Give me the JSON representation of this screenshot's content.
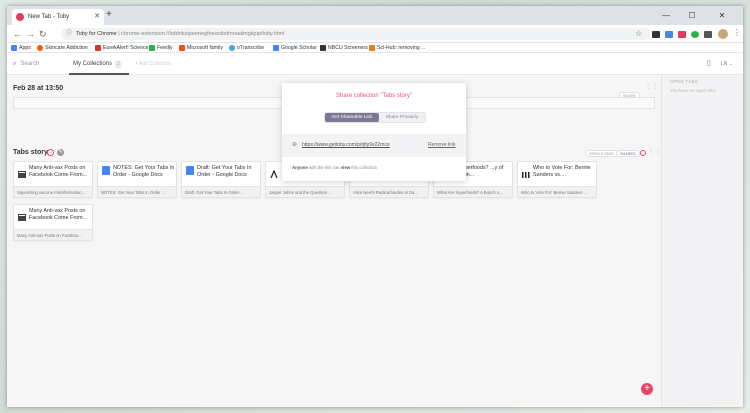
{
  "tab": {
    "title": "New Tab - Toby",
    "new": "+"
  },
  "window": {
    "min": "—",
    "max": "☐",
    "close": "✕"
  },
  "address": {
    "lock": "ⓘ",
    "host": "Toby for Chrome",
    "path": "chrome-extension://hddnkoipeenegfoeaoibdmnaalmgkpip/toby.html",
    "star": "☆"
  },
  "bookmarks": [
    {
      "label": "Apps",
      "color": "#4a86e8"
    },
    {
      "label": "Skincare Addiction",
      "color": "#ff5700"
    },
    {
      "label": "EurekAlert! Science ...",
      "color": "#d33"
    },
    {
      "label": "Feedly",
      "color": "#2bb24c"
    },
    {
      "label": "Microsoft family",
      "color": "#f25022"
    },
    {
      "label": "oTranscribe",
      "color": "#4aa3df"
    },
    {
      "label": "Google Scholar",
      "color": "#4285f4"
    },
    {
      "label": "NBCU Screeners",
      "color": "#333"
    },
    {
      "label": "Sci-Hub: removing ...",
      "color": "#e67e22"
    }
  ],
  "toolbar": {
    "search": "Search",
    "search_icon": "⌕",
    "collections": "My Collections",
    "count": "2",
    "add": "+ Add Collection"
  },
  "sidebar": {
    "heading": "OPEN TABS",
    "empty": "You have no open tabs"
  },
  "section1": {
    "title": "Feb 28 at 13:50",
    "share": "SHARE"
  },
  "section2": {
    "title": "Tabs story",
    "open": "OPEN 9 TABS",
    "share": "SHARED"
  },
  "cards": [
    {
      "title": "Many Anti-vax Posts on Facebook Come From...",
      "url": "Squelching vaccine misinformation...",
      "icon": "news"
    },
    {
      "title": "NOTES: Get Your Tabs In Order - Google Docs",
      "url": "NOTES: Get Your Tabs In Order ...",
      "icon": "doc"
    },
    {
      "title": "Draft: Get Your Tabs In Order - Google Docs",
      "url": "Draft: Get Your Tabs In Order ...",
      "icon": "doc"
    },
    {
      "title": "",
      "url": "Jasper Johns and the Question ...",
      "icon": "art"
    },
    {
      "title": "",
      "url": "Alice Neel's Radical Nudes at Da...",
      "icon": "art"
    },
    {
      "title": "...e Superfoods? ...y of Marketin...",
      "url": "What Are Superfoods? A Bunch o...",
      "icon": "news"
    },
    {
      "title": "Who to Vote For: Bernie Sanders vs....",
      "url": "Who to Vote For: Bernie Sanders ...",
      "icon": "nyt"
    },
    {
      "title": "Many Anti-vax Posts on Facebook Come From...",
      "url": "Many Anti-vax Posts on Faceboo...",
      "icon": "news"
    }
  ],
  "modal": {
    "title": "Share collection \"Tabs story\"",
    "active": "Get Shareable Link",
    "inactive": "Share Privately",
    "link": "https://www.gettoby.com/p/qtly9v22rnce",
    "remove": "Remove link",
    "note_a": "Anyone",
    "note_b": " with the link can ",
    "note_c": "view",
    "note_d": " this collection"
  },
  "fab": "+"
}
